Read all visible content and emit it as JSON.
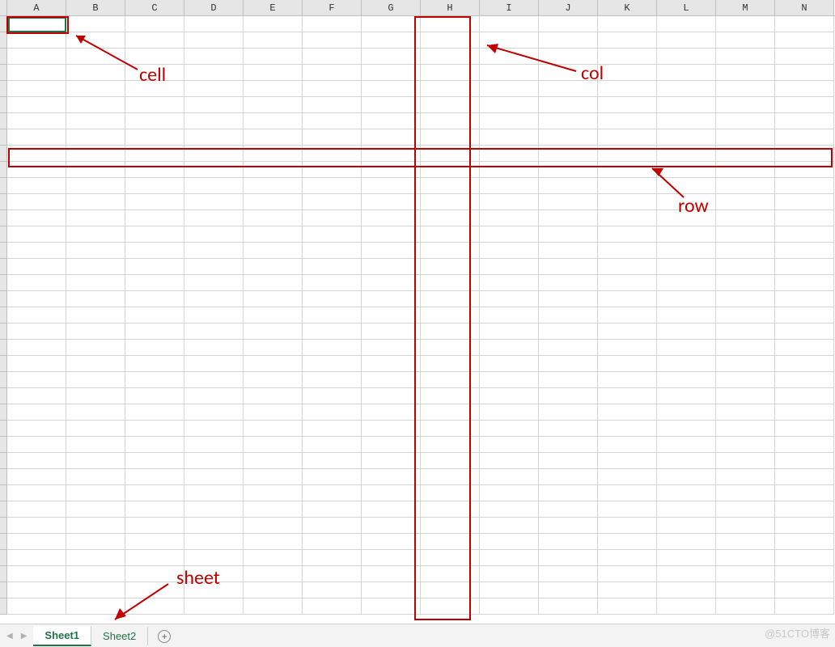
{
  "columns": [
    "A",
    "B",
    "C",
    "D",
    "E",
    "F",
    "G",
    "H",
    "I",
    "J",
    "K",
    "L",
    "M",
    "N"
  ],
  "row_count": 37,
  "selected_cell_ref": "A1",
  "annotations": {
    "cell_label": "cell",
    "col_label": "col",
    "row_label": "row",
    "sheet_label": "sheet"
  },
  "tabs": {
    "active": "Sheet1",
    "inactive": "Sheet2",
    "add_icon": "+"
  },
  "nav": {
    "prev": "◀",
    "next": "▶"
  },
  "watermark": "@51CTO博客",
  "colors": {
    "annotation": "#c00000",
    "excel_accent": "#217346"
  }
}
